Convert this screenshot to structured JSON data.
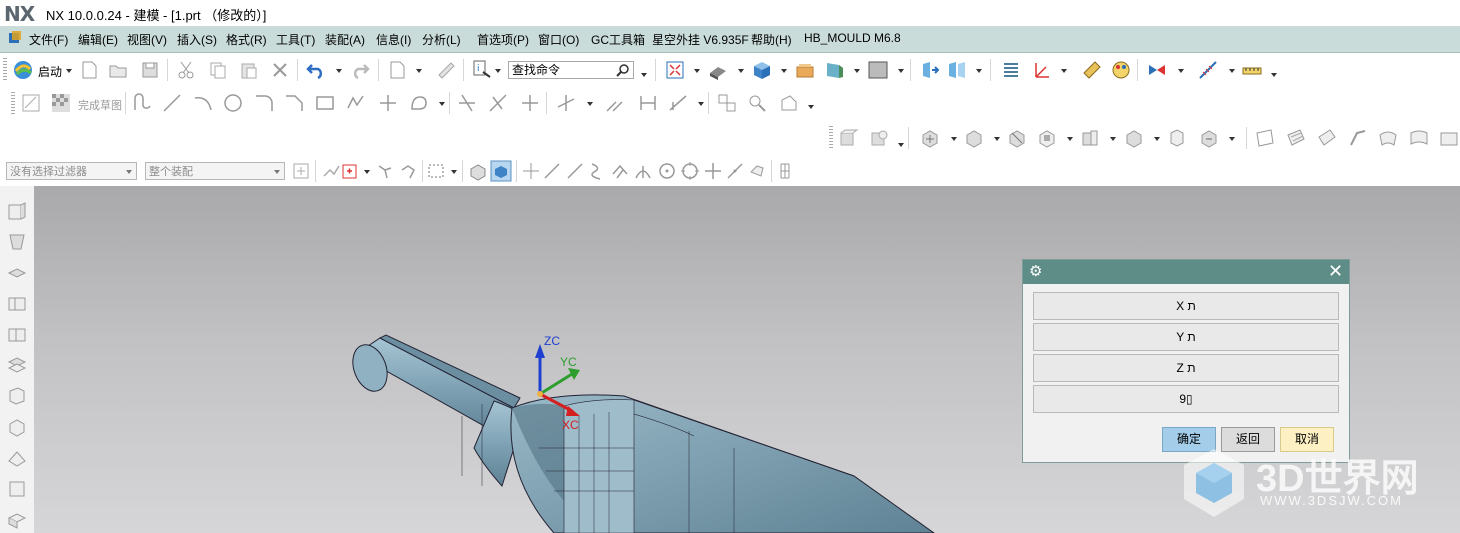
{
  "window": {
    "logo": "NX",
    "title": "NX 10.0.0.24 - 建模 - [1.prt （修改的）]"
  },
  "menubar": {
    "items": [
      {
        "label": "文件(F)"
      },
      {
        "label": "编辑(E)"
      },
      {
        "label": "视图(V)"
      },
      {
        "label": "插入(S)"
      },
      {
        "label": "格式(R)"
      },
      {
        "label": "工具(T)"
      },
      {
        "label": "装配(A)"
      },
      {
        "label": "信息(I)"
      },
      {
        "label": "分析(L)"
      },
      {
        "label": "首选项(P)"
      },
      {
        "label": "窗口(O)"
      },
      {
        "label": "GC工具箱"
      },
      {
        "label": "星空外挂 V6.935F"
      },
      {
        "label": "帮助(H)"
      },
      {
        "label": "HB_MOULD M6.8"
      }
    ]
  },
  "toolbar": {
    "start_label": "启动",
    "search_placeholder": "查找命令",
    "finish_sketch_label": "完成草图"
  },
  "selection_bar": {
    "filter_value": "没有选择过滤器",
    "scope_value": "整个装配"
  },
  "viewport": {
    "csys": {
      "z_label": "ZC",
      "y_label": "YC",
      "x_label": "XC"
    },
    "colors": {
      "part": "#7fa3b5",
      "z_axis": "#1f3fd0",
      "y_axis": "#2d9e2d",
      "x_axis": "#d42020"
    }
  },
  "dialog": {
    "options": [
      {
        "label": "X ת"
      },
      {
        "label": "Y ת"
      },
      {
        "label": "Z ת"
      },
      {
        "label": "9▯"
      }
    ],
    "ok_label": "确定",
    "back_label": "返回",
    "cancel_label": "取消",
    "header_color": "#5e8d87"
  },
  "watermark": {
    "brand": "3D世界网",
    "url": "WWW.3DSJW.COM"
  }
}
